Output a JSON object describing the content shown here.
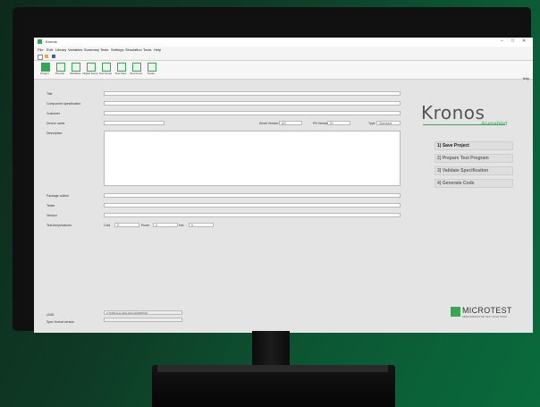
{
  "window": {
    "title": "Kronos",
    "controls": [
      "–",
      "□",
      "✕"
    ]
  },
  "menu": [
    "File",
    "Edit",
    "Library",
    "Variables",
    "Summary",
    "Tests",
    "Settings",
    "Simulation",
    "Tools",
    "Help"
  ],
  "ribbon": {
    "buttons": [
      "Project",
      "Pinouts",
      "Variables",
      "Digital Setup",
      "Test Setup",
      "Test Flow",
      "Test Items",
      "Tester"
    ],
    "help_label": "Help"
  },
  "form": {
    "title_label": "Title",
    "component_label": "Component specification",
    "customer_label": "Customer",
    "device_label": "Device name",
    "email_label": "Email Version",
    "email_value": "AS",
    "pn_label": "PN Version",
    "pn_value": "01",
    "type_label": "Type",
    "type_value": "Standard",
    "description_label": "Description",
    "package_label": "Package outline",
    "tester_label": "Tester",
    "version_label": "Version",
    "temp_label": "Test temperatures",
    "cold_label": "Cold",
    "cold_value": "0",
    "room_label": "Room",
    "room_value": "0",
    "hot_label": "Hot",
    "hot_value": "0",
    "uuid_label": "UUID",
    "uuid_value": "1c7b3f6b-6ee2-4a8a-a6b2-bd30d9f57a61",
    "spec_label": "Spec format version"
  },
  "branding": {
    "kronos": "Kronos",
    "kronos_sub": "AI-enabled",
    "microtest": "MICROTEST",
    "microtest_tag": "SEMICONDUCTOR TEST SOLUTIONS"
  },
  "actions": [
    "1) Save Project",
    "2) Prepare Test Program",
    "3) Validate Specification",
    "4) Generate Code"
  ],
  "colors": {
    "accent": "#3aa655"
  }
}
